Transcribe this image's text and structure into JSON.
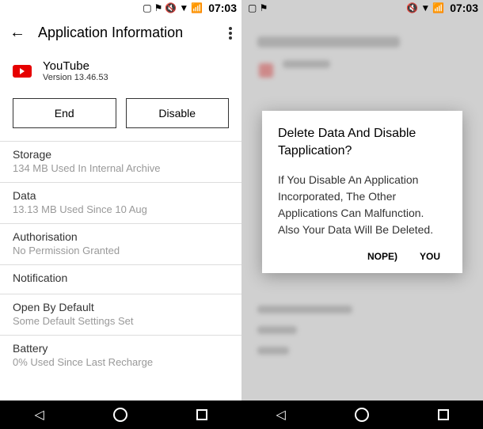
{
  "status": {
    "clock": "07:03",
    "clock2": "07:03"
  },
  "header": {
    "title": "Application Information"
  },
  "app": {
    "name": "YouTube",
    "version": "Version 13.46.53"
  },
  "buttons": {
    "end": "End",
    "disable": "Disable"
  },
  "sections": {
    "storage_label": "Storage",
    "storage_value": "134 MB Used In Internal Archive",
    "data_label": "Data",
    "data_value": "13.13 MB Used Since 10 Aug",
    "auth_label": "Authorisation",
    "auth_value": "No Permission Granted",
    "notif_label": "Notification",
    "open_label": "Open By Default",
    "open_value": "Some Default Settings Set",
    "battery_label": "Battery",
    "battery_value": "0% Used Since Last Recharge"
  },
  "dialog": {
    "title": "Delete Data And Disable Tapplication?",
    "body": "If You Disable An Application Incorporated, The Other Applications Can Malfunction. Also Your Data Will Be Deleted.",
    "nope": "NOPE)",
    "you": "YOU"
  }
}
